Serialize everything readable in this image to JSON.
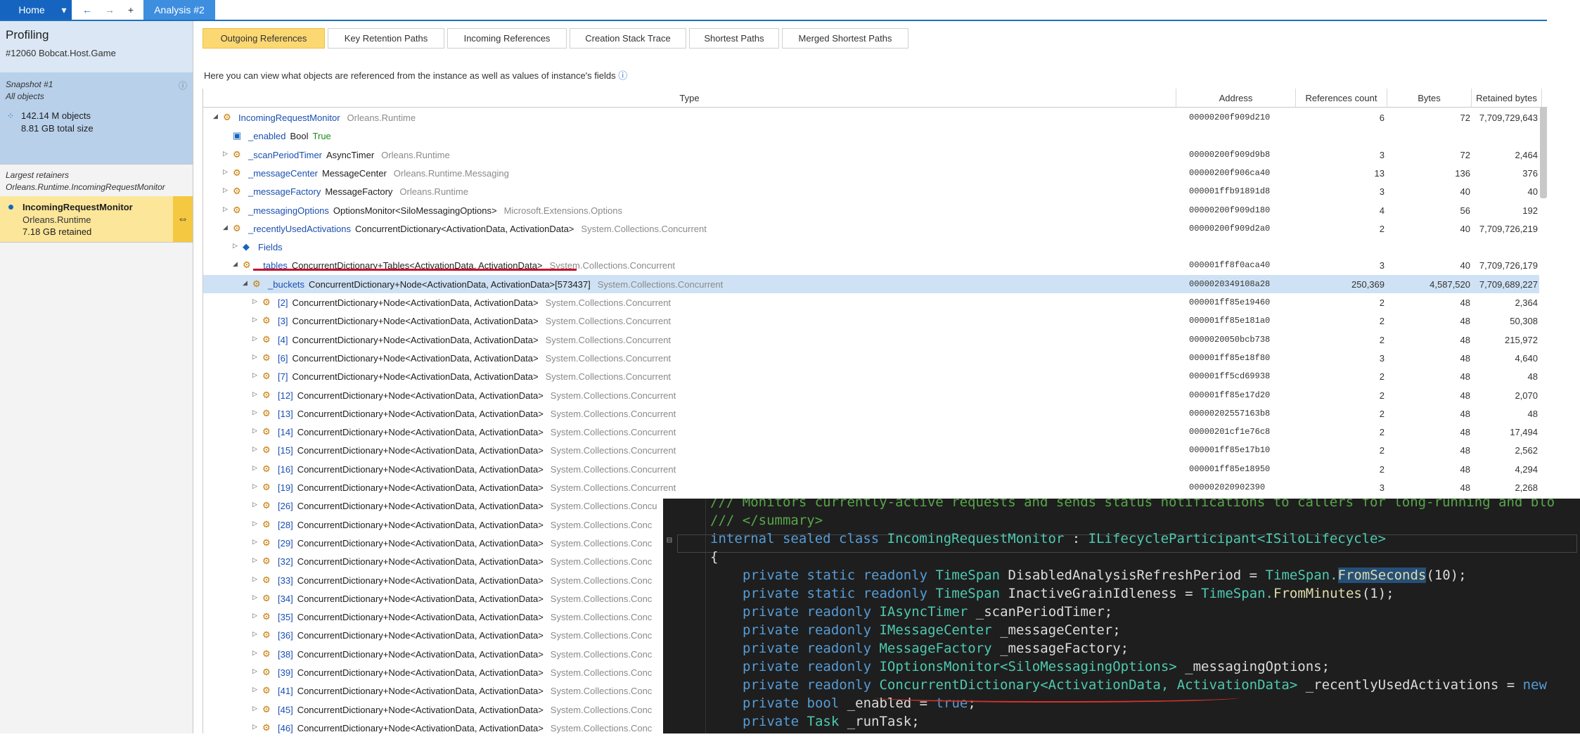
{
  "topbar": {
    "home": "Home",
    "dropdown": "▾",
    "back": "←",
    "forward": "→",
    "add": "+",
    "tab": "Analysis #2"
  },
  "sidebar": {
    "title": "Profiling",
    "subtitle": "#12060 Bobcat.Host.Game",
    "snapshot": "Snapshot #1",
    "snapshot_sub": "All objects",
    "objects": "142.14 M objects",
    "size": "8.81 GB total size",
    "largest_title": "Largest retainers",
    "largest_sub": "Orleans.Runtime.IncomingRequestMonitor",
    "retainer": {
      "name": "IncomingRequestMonitor",
      "ns": "Orleans.Runtime",
      "size": "7.18 GB retained"
    }
  },
  "tabs": [
    "Outgoing References",
    "Key Retention Paths",
    "Incoming References",
    "Creation Stack Trace",
    "Shortest Paths",
    "Merged Shortest Paths"
  ],
  "hint": "Here you can view what objects are referenced from the instance as well as values of instance's fields",
  "columns": {
    "type": "Type",
    "address": "Address",
    "refs": "References count",
    "bytes": "Bytes",
    "retained": "Retained bytes"
  },
  "rows": [
    {
      "exp": "◢",
      "name": "IncomingRequestMonitor",
      "type": "",
      "ns": "Orleans.Runtime",
      "addr": "00000200f909d210",
      "refs": "6",
      "bytes": "72",
      "ret": "7,709,729,643"
    },
    {
      "exp": "",
      "name": "_enabled",
      "type": "Bool",
      "val": "True",
      "ns": "",
      "addr": "",
      "refs": "",
      "bytes": "",
      "ret": ""
    },
    {
      "exp": "▷",
      "name": "_scanPeriodTimer",
      "type": "AsyncTimer",
      "ns": "Orleans.Runtime",
      "addr": "00000200f909d9b8",
      "refs": "3",
      "bytes": "72",
      "ret": "2,464"
    },
    {
      "exp": "▷",
      "name": "_messageCenter",
      "type": "MessageCenter",
      "ns": "Orleans.Runtime.Messaging",
      "addr": "00000200f906ca40",
      "refs": "13",
      "bytes": "136",
      "ret": "376"
    },
    {
      "exp": "▷",
      "name": "_messageFactory",
      "type": "MessageFactory",
      "ns": "Orleans.Runtime",
      "addr": "000001ffb91891d8",
      "refs": "3",
      "bytes": "40",
      "ret": "40"
    },
    {
      "exp": "▷",
      "name": "_messagingOptions",
      "type": "OptionsMonitor<SiloMessagingOptions>",
      "ns": "Microsoft.Extensions.Options",
      "addr": "00000200f909d180",
      "refs": "4",
      "bytes": "56",
      "ret": "192"
    },
    {
      "exp": "◢",
      "name": "_recentlyUsedActivations",
      "type": "ConcurrentDictionary<ActivationData, ActivationData>",
      "ns": "System.Collections.Concurrent",
      "addr": "00000200f909d2a0",
      "refs": "2",
      "bytes": "40",
      "ret": "7,709,726,219"
    },
    {
      "exp": "▷",
      "name": "Fields",
      "type": "",
      "ns": "",
      "addr": "",
      "refs": "",
      "bytes": "",
      "ret": ""
    },
    {
      "exp": "◢",
      "name": "_tables",
      "type": "ConcurrentDictionary+Tables<ActivationData, ActivationData>",
      "ns": "System.Collections.Concurrent",
      "addr": "000001ff8f0aca40",
      "refs": "3",
      "bytes": "40",
      "ret": "7,709,726,179"
    },
    {
      "exp": "◢",
      "name": "_buckets",
      "type": "ConcurrentDictionary+Node<ActivationData, ActivationData>[573437]",
      "ns": "System.Collections.Concurrent",
      "addr": "0000020349108a28",
      "refs": "250,369",
      "bytes": "4,587,520",
      "ret": "7,709,689,227"
    },
    {
      "exp": "▷",
      "name": "[2]",
      "type": "ConcurrentDictionary+Node<ActivationData, ActivationData>",
      "ns": "System.Collections.Concurrent",
      "addr": "000001ff85e19460",
      "refs": "2",
      "bytes": "48",
      "ret": "2,364"
    },
    {
      "exp": "▷",
      "name": "[3]",
      "type": "ConcurrentDictionary+Node<ActivationData, ActivationData>",
      "ns": "System.Collections.Concurrent",
      "addr": "000001ff85e181a0",
      "refs": "2",
      "bytes": "48",
      "ret": "50,308"
    },
    {
      "exp": "▷",
      "name": "[4]",
      "type": "ConcurrentDictionary+Node<ActivationData, ActivationData>",
      "ns": "System.Collections.Concurrent",
      "addr": "0000020050bcb738",
      "refs": "2",
      "bytes": "48",
      "ret": "215,972"
    },
    {
      "exp": "▷",
      "name": "[6]",
      "type": "ConcurrentDictionary+Node<ActivationData, ActivationData>",
      "ns": "System.Collections.Concurrent",
      "addr": "000001ff85e18f80",
      "refs": "3",
      "bytes": "48",
      "ret": "4,640"
    },
    {
      "exp": "▷",
      "name": "[7]",
      "type": "ConcurrentDictionary+Node<ActivationData, ActivationData>",
      "ns": "System.Collections.Concurrent",
      "addr": "000001ff5cd69938",
      "refs": "2",
      "bytes": "48",
      "ret": "48"
    },
    {
      "exp": "▷",
      "name": "[12]",
      "type": "ConcurrentDictionary+Node<ActivationData, ActivationData>",
      "ns": "System.Collections.Concurrent",
      "addr": "000001ff85e17d20",
      "refs": "2",
      "bytes": "48",
      "ret": "2,070"
    },
    {
      "exp": "▷",
      "name": "[13]",
      "type": "ConcurrentDictionary+Node<ActivationData, ActivationData>",
      "ns": "System.Collections.Concurrent",
      "addr": "00000202557163b8",
      "refs": "2",
      "bytes": "48",
      "ret": "48"
    },
    {
      "exp": "▷",
      "name": "[14]",
      "type": "ConcurrentDictionary+Node<ActivationData, ActivationData>",
      "ns": "System.Collections.Concurrent",
      "addr": "00000201cf1e76c8",
      "refs": "2",
      "bytes": "48",
      "ret": "17,494"
    },
    {
      "exp": "▷",
      "name": "[15]",
      "type": "ConcurrentDictionary+Node<ActivationData, ActivationData>",
      "ns": "System.Collections.Concurrent",
      "addr": "000001ff85e17b10",
      "refs": "2",
      "bytes": "48",
      "ret": "2,562"
    },
    {
      "exp": "▷",
      "name": "[16]",
      "type": "ConcurrentDictionary+Node<ActivationData, ActivationData>",
      "ns": "System.Collections.Concurrent",
      "addr": "000001ff85e18950",
      "refs": "2",
      "bytes": "48",
      "ret": "4,294"
    },
    {
      "exp": "▷",
      "name": "[19]",
      "type": "ConcurrentDictionary+Node<ActivationData, ActivationData>",
      "ns": "System.Collections.Concurrent",
      "addr": "000002020902390",
      "refs": "3",
      "bytes": "48",
      "ret": "2,268"
    },
    {
      "exp": "▷",
      "name": "[26]",
      "type": "ConcurrentDictionary+Node<ActivationData, ActivationData>",
      "ns": "System.Collections.Concu",
      "addr": "",
      "refs": "",
      "bytes": "",
      "ret": ""
    },
    {
      "exp": "▷",
      "name": "[28]",
      "type": "ConcurrentDictionary+Node<ActivationData, ActivationData>",
      "ns": "System.Collections.Conc",
      "addr": "",
      "refs": "",
      "bytes": "",
      "ret": ""
    },
    {
      "exp": "▷",
      "name": "[29]",
      "type": "ConcurrentDictionary+Node<ActivationData, ActivationData>",
      "ns": "System.Collections.Conc",
      "addr": "",
      "refs": "",
      "bytes": "",
      "ret": ""
    },
    {
      "exp": "▷",
      "name": "[32]",
      "type": "ConcurrentDictionary+Node<ActivationData, ActivationData>",
      "ns": "System.Collections.Conc",
      "addr": "",
      "refs": "",
      "bytes": "",
      "ret": ""
    },
    {
      "exp": "▷",
      "name": "[33]",
      "type": "ConcurrentDictionary+Node<ActivationData, ActivationData>",
      "ns": "System.Collections.Conc",
      "addr": "",
      "refs": "",
      "bytes": "",
      "ret": ""
    },
    {
      "exp": "▷",
      "name": "[34]",
      "type": "ConcurrentDictionary+Node<ActivationData, ActivationData>",
      "ns": "System.Collections.Conc",
      "addr": "",
      "refs": "",
      "bytes": "",
      "ret": ""
    },
    {
      "exp": "▷",
      "name": "[35]",
      "type": "ConcurrentDictionary+Node<ActivationData, ActivationData>",
      "ns": "System.Collections.Conc",
      "addr": "",
      "refs": "",
      "bytes": "",
      "ret": ""
    },
    {
      "exp": "▷",
      "name": "[36]",
      "type": "ConcurrentDictionary+Node<ActivationData, ActivationData>",
      "ns": "System.Collections.Conc",
      "addr": "",
      "refs": "",
      "bytes": "",
      "ret": ""
    },
    {
      "exp": "▷",
      "name": "[38]",
      "type": "ConcurrentDictionary+Node<ActivationData, ActivationData>",
      "ns": "System.Collections.Conc",
      "addr": "",
      "refs": "",
      "bytes": "",
      "ret": ""
    },
    {
      "exp": "▷",
      "name": "[39]",
      "type": "ConcurrentDictionary+Node<ActivationData, ActivationData>",
      "ns": "System.Collections.Conc",
      "addr": "",
      "refs": "",
      "bytes": "",
      "ret": ""
    },
    {
      "exp": "▷",
      "name": "[41]",
      "type": "ConcurrentDictionary+Node<ActivationData, ActivationData>",
      "ns": "System.Collections.Conc",
      "addr": "",
      "refs": "",
      "bytes": "",
      "ret": ""
    },
    {
      "exp": "▷",
      "name": "[45]",
      "type": "ConcurrentDictionary+Node<ActivationData, ActivationData>",
      "ns": "System.Collections.Conc",
      "addr": "",
      "refs": "",
      "bytes": "",
      "ret": ""
    },
    {
      "exp": "▷",
      "name": "[46]",
      "type": "ConcurrentDictionary+Node<ActivationData, ActivationData>",
      "ns": "System.Collections.Conc",
      "addr": "",
      "refs": "",
      "bytes": "",
      "ret": ""
    }
  ],
  "code": {
    "l1": "/// Monitors currently-active requests and sends status notifications to callers for long-running and blo",
    "l2": "/// </summary>",
    "l3a": "internal sealed class ",
    "l3b": "IncomingRequestMonitor",
    "l3c": " : ",
    "l3d": "ILifecycleParticipant<ISiloLifecycle>",
    "l4": "{",
    "l5a": "private static readonly ",
    "l5b": "TimeSpan",
    "l5c": " DisabledAnalysisRefreshPeriod = ",
    "l5d": "TimeSpan.",
    "l5e": "FromSeconds",
    "l5f": "(10);",
    "l6a": "private static readonly ",
    "l6b": "TimeSpan",
    "l6c": " InactiveGrainIdleness = ",
    "l6d": "TimeSpan.",
    "l6e": "FromMinutes",
    "l6f": "(1);",
    "l7a": "private readonly ",
    "l7b": "IAsyncTimer",
    "l7c": " _scanPeriodTimer;",
    "l8a": "private readonly ",
    "l8b": "IMessageCenter",
    "l8c": " _messageCenter;",
    "l9a": "private readonly ",
    "l9b": "MessageFactory",
    "l9c": " _messageFactory;",
    "l10a": "private readonly ",
    "l10b": "IOptionsMonitor<SiloMessagingOptions>",
    "l10c": " _messagingOptions;",
    "l11a": "private readonly ",
    "l11b": "ConcurrentDictionary<ActivationData, ActivationData>",
    "l11c": " _recentlyUsedActivations = ",
    "l11d": "new",
    "l12a": "private bool",
    "l12b": " _enabled = ",
    "l12c": "true",
    ";": ";",
    "l13a": "private ",
    "l13b": "Task",
    "l13c": " _runTask;"
  }
}
